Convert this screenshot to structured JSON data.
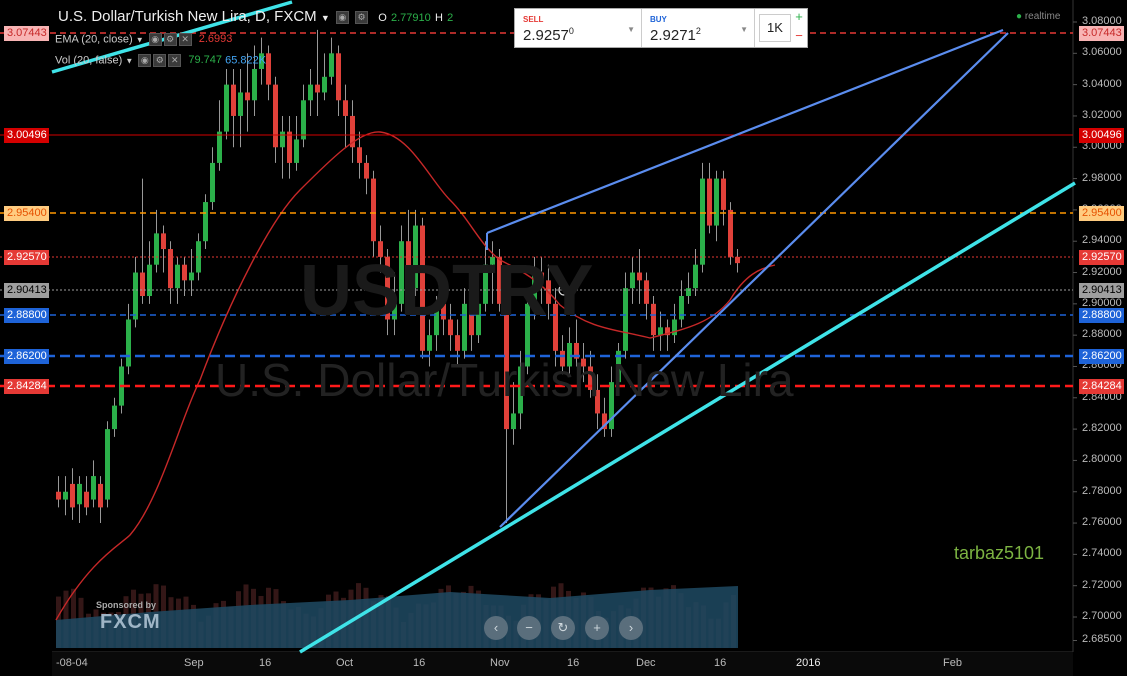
{
  "header": {
    "symbol": "U.S. Dollar/Turkish New Lira, D, FXCM",
    "ohlc_o_label": "O",
    "ohlc_o_value": "2.77910",
    "ohlc_h_label": "H",
    "ohlc_h_value": "2",
    "ema_label": "EMA (20, close)",
    "ema_value": "2.6993",
    "vol_label": "Vol (20, false)",
    "vol_value1": "79.747",
    "vol_value2": "65.822K",
    "realtime": "realtime"
  },
  "trade": {
    "sell_label": "SELL",
    "sell_price_main": "2.9257",
    "sell_price_sup": "0",
    "buy_label": "BUY",
    "buy_price_main": "2.9271",
    "buy_price_sup": "2",
    "qty": "1K",
    "plus": "+",
    "minus": "−"
  },
  "watermark": {
    "big": "USDTRY",
    "sub": "U.S. Dollar/Turkish New Lira"
  },
  "author": "tarbaz5101",
  "sponsor": {
    "label": "Sponsored by",
    "brand": "FXCM"
  },
  "nav": [
    "‹",
    "−",
    "↻",
    "+",
    "›"
  ],
  "x_axis": [
    "-08-04",
    "Sep",
    "16",
    "Oct",
    "16",
    "Nov",
    "16",
    "Dec",
    "16",
    "2016",
    "Feb"
  ],
  "y_axis": [
    "3.08000",
    "3.06000",
    "3.04000",
    "3.02000",
    "3.00000",
    "2.98000",
    "2.96000",
    "2.94000",
    "2.92000",
    "2.90000",
    "2.88000",
    "2.86000",
    "2.84000",
    "2.82000",
    "2.80000",
    "2.78000",
    "2.76000",
    "2.74000",
    "2.72000",
    "2.70000",
    "2.68500"
  ],
  "levels": [
    {
      "name": "level-307443",
      "label": "3.07443",
      "color": "#e53935",
      "style": "dash",
      "bg": "#f8b4b4",
      "fg": "#c62828"
    },
    {
      "name": "level-300496",
      "label": "3.00496",
      "color": "#d50000",
      "style": "solid",
      "bg": "#d50000",
      "fg": "#ffffff"
    },
    {
      "name": "level-295400",
      "label": "2.95400",
      "color": "#ff9800",
      "style": "dash",
      "bg": "#ffcc80",
      "fg": "#e65100"
    },
    {
      "name": "level-292570",
      "label": "2.92570",
      "color": "#e53935",
      "style": "dot",
      "bg": "#e53935",
      "fg": "#ffffff"
    },
    {
      "name": "level-290413",
      "label": "2.90413",
      "color": "#9e9e9e",
      "style": "dot",
      "bg": "#9e9e9e",
      "fg": "#000000"
    },
    {
      "name": "level-288800",
      "label": "2.88800",
      "color": "#1e63d8",
      "style": "dash",
      "bg": "#1e63d8",
      "fg": "#ffffff"
    },
    {
      "name": "level-286200",
      "label": "2.86200",
      "color": "#1e63d8",
      "style": "bigdash",
      "bg": "#1e63d8",
      "fg": "#ffffff"
    },
    {
      "name": "level-284284",
      "label": "2.84284",
      "color": "#ff1a1a",
      "style": "bigdash",
      "bg": "#e53935",
      "fg": "#ffffff"
    }
  ],
  "colors": {
    "up": "#2bb04a",
    "down": "#e0413a",
    "ema": "#c62828",
    "trend": "#5b8def",
    "cyan": "#3fe3e8",
    "volume": "#2a5a73"
  }
}
